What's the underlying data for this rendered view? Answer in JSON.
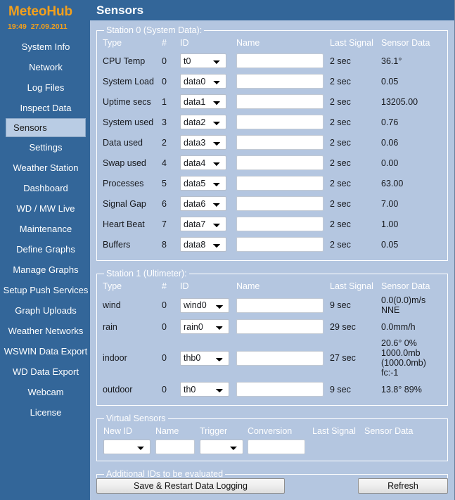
{
  "sidebar": {
    "brand": "MeteoHub",
    "clock": "19:49  27.09.2011",
    "items": [
      {
        "label": "System Info",
        "selected": false
      },
      {
        "label": "Network",
        "selected": false
      },
      {
        "label": "Log Files",
        "selected": false
      },
      {
        "label": "Inspect Data",
        "selected": false
      },
      {
        "label": "Sensors",
        "selected": true
      },
      {
        "label": "Settings",
        "selected": false
      },
      {
        "label": "Weather Station",
        "selected": false
      },
      {
        "label": "Dashboard",
        "selected": false
      },
      {
        "label": "WD / MW Live",
        "selected": false
      },
      {
        "label": "Maintenance",
        "selected": false
      },
      {
        "label": "Define Graphs",
        "selected": false
      },
      {
        "label": "Manage Graphs",
        "selected": false
      },
      {
        "label": "Setup Push Services",
        "selected": false
      },
      {
        "label": "Graph Uploads",
        "selected": false
      },
      {
        "label": "Weather Networks",
        "selected": false
      },
      {
        "label": "WSWIN Data Export",
        "selected": false
      },
      {
        "label": "WD Data Export",
        "selected": false
      },
      {
        "label": "Webcam",
        "selected": false
      },
      {
        "label": "License",
        "selected": false
      }
    ]
  },
  "header": {
    "title": "Sensors"
  },
  "columns": {
    "type": "Type",
    "num": "#",
    "id": "ID",
    "name": "Name",
    "last_signal": "Last Signal",
    "sensor_data": "Sensor Data"
  },
  "station0": {
    "legend": "Station 0 (System Data):",
    "rows": [
      {
        "type": "CPU Temp",
        "num": "0",
        "id": "t0",
        "name": "",
        "last_signal": "2 sec",
        "sensor_data": "36.1°"
      },
      {
        "type": "System Load",
        "num": "0",
        "id": "data0",
        "name": "",
        "last_signal": "2 sec",
        "sensor_data": "0.05"
      },
      {
        "type": "Uptime secs",
        "num": "1",
        "id": "data1",
        "name": "",
        "last_signal": "2 sec",
        "sensor_data": "13205.00"
      },
      {
        "type": "System used",
        "num": "3",
        "id": "data2",
        "name": "",
        "last_signal": "2 sec",
        "sensor_data": "0.76"
      },
      {
        "type": "Data used",
        "num": "2",
        "id": "data3",
        "name": "",
        "last_signal": "2 sec",
        "sensor_data": "0.06"
      },
      {
        "type": "Swap used",
        "num": "4",
        "id": "data4",
        "name": "",
        "last_signal": "2 sec",
        "sensor_data": "0.00"
      },
      {
        "type": "Processes",
        "num": "5",
        "id": "data5",
        "name": "",
        "last_signal": "2 sec",
        "sensor_data": "63.00"
      },
      {
        "type": "Signal Gap",
        "num": "6",
        "id": "data6",
        "name": "",
        "last_signal": "2 sec",
        "sensor_data": "7.00"
      },
      {
        "type": "Heart Beat",
        "num": "7",
        "id": "data7",
        "name": "",
        "last_signal": "2 sec",
        "sensor_data": "1.00"
      },
      {
        "type": "Buffers",
        "num": "8",
        "id": "data8",
        "name": "",
        "last_signal": "2 sec",
        "sensor_data": "0.05"
      }
    ]
  },
  "station1": {
    "legend": "Station 1 (Ultimeter):",
    "rows": [
      {
        "type": "wind",
        "num": "0",
        "id": "wind0",
        "name": "",
        "last_signal": "9 sec",
        "sensor_data": "0.0(0.0)m/s NNE"
      },
      {
        "type": "rain",
        "num": "0",
        "id": "rain0",
        "name": "",
        "last_signal": "29 sec",
        "sensor_data": "0.0mm/h"
      },
      {
        "type": "indoor",
        "num": "0",
        "id": "thb0",
        "name": "",
        "last_signal": "27 sec",
        "sensor_data": "20.6° 0% 1000.0mb\n(1000.0mb) fc:-1"
      },
      {
        "type": "outdoor",
        "num": "0",
        "id": "th0",
        "name": "",
        "last_signal": "9 sec",
        "sensor_data": "13.8° 89%"
      }
    ]
  },
  "virtual_sensors": {
    "legend": "Virtual Sensors",
    "columns": {
      "new_id": "New ID",
      "name": "Name",
      "trigger": "Trigger",
      "conversion": "Conversion",
      "last_signal": "Last Signal",
      "sensor_data": "Sensor Data"
    },
    "row": {
      "new_id": "",
      "name": "",
      "trigger": "",
      "conversion": "",
      "last_signal": "",
      "sensor_data": ""
    }
  },
  "additional_ids": {
    "legend": "Additional IDs to be evaluated",
    "select_value": "",
    "text_value": ""
  },
  "buttons": {
    "save": "Save & Restart Data Logging",
    "refresh": "Refresh"
  },
  "colors": {
    "sidebar_bg": "#336699",
    "brand": "#f3a01c",
    "content_bg": "#b4c6e0",
    "selected_item_bg": "#b9cce4",
    "panel_border": "#ffffff"
  }
}
